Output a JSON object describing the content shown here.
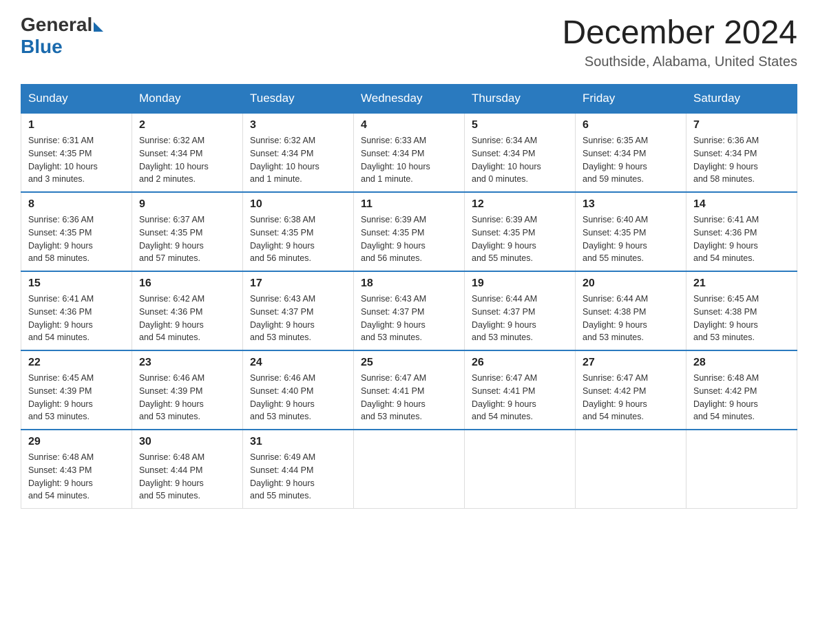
{
  "header": {
    "logo_general": "General",
    "logo_blue": "Blue",
    "title": "December 2024",
    "subtitle": "Southside, Alabama, United States"
  },
  "days_of_week": [
    "Sunday",
    "Monday",
    "Tuesday",
    "Wednesday",
    "Thursday",
    "Friday",
    "Saturday"
  ],
  "weeks": [
    [
      {
        "day": "1",
        "info": "Sunrise: 6:31 AM\nSunset: 4:35 PM\nDaylight: 10 hours\nand 3 minutes."
      },
      {
        "day": "2",
        "info": "Sunrise: 6:32 AM\nSunset: 4:34 PM\nDaylight: 10 hours\nand 2 minutes."
      },
      {
        "day": "3",
        "info": "Sunrise: 6:32 AM\nSunset: 4:34 PM\nDaylight: 10 hours\nand 1 minute."
      },
      {
        "day": "4",
        "info": "Sunrise: 6:33 AM\nSunset: 4:34 PM\nDaylight: 10 hours\nand 1 minute."
      },
      {
        "day": "5",
        "info": "Sunrise: 6:34 AM\nSunset: 4:34 PM\nDaylight: 10 hours\nand 0 minutes."
      },
      {
        "day": "6",
        "info": "Sunrise: 6:35 AM\nSunset: 4:34 PM\nDaylight: 9 hours\nand 59 minutes."
      },
      {
        "day": "7",
        "info": "Sunrise: 6:36 AM\nSunset: 4:34 PM\nDaylight: 9 hours\nand 58 minutes."
      }
    ],
    [
      {
        "day": "8",
        "info": "Sunrise: 6:36 AM\nSunset: 4:35 PM\nDaylight: 9 hours\nand 58 minutes."
      },
      {
        "day": "9",
        "info": "Sunrise: 6:37 AM\nSunset: 4:35 PM\nDaylight: 9 hours\nand 57 minutes."
      },
      {
        "day": "10",
        "info": "Sunrise: 6:38 AM\nSunset: 4:35 PM\nDaylight: 9 hours\nand 56 minutes."
      },
      {
        "day": "11",
        "info": "Sunrise: 6:39 AM\nSunset: 4:35 PM\nDaylight: 9 hours\nand 56 minutes."
      },
      {
        "day": "12",
        "info": "Sunrise: 6:39 AM\nSunset: 4:35 PM\nDaylight: 9 hours\nand 55 minutes."
      },
      {
        "day": "13",
        "info": "Sunrise: 6:40 AM\nSunset: 4:35 PM\nDaylight: 9 hours\nand 55 minutes."
      },
      {
        "day": "14",
        "info": "Sunrise: 6:41 AM\nSunset: 4:36 PM\nDaylight: 9 hours\nand 54 minutes."
      }
    ],
    [
      {
        "day": "15",
        "info": "Sunrise: 6:41 AM\nSunset: 4:36 PM\nDaylight: 9 hours\nand 54 minutes."
      },
      {
        "day": "16",
        "info": "Sunrise: 6:42 AM\nSunset: 4:36 PM\nDaylight: 9 hours\nand 54 minutes."
      },
      {
        "day": "17",
        "info": "Sunrise: 6:43 AM\nSunset: 4:37 PM\nDaylight: 9 hours\nand 53 minutes."
      },
      {
        "day": "18",
        "info": "Sunrise: 6:43 AM\nSunset: 4:37 PM\nDaylight: 9 hours\nand 53 minutes."
      },
      {
        "day": "19",
        "info": "Sunrise: 6:44 AM\nSunset: 4:37 PM\nDaylight: 9 hours\nand 53 minutes."
      },
      {
        "day": "20",
        "info": "Sunrise: 6:44 AM\nSunset: 4:38 PM\nDaylight: 9 hours\nand 53 minutes."
      },
      {
        "day": "21",
        "info": "Sunrise: 6:45 AM\nSunset: 4:38 PM\nDaylight: 9 hours\nand 53 minutes."
      }
    ],
    [
      {
        "day": "22",
        "info": "Sunrise: 6:45 AM\nSunset: 4:39 PM\nDaylight: 9 hours\nand 53 minutes."
      },
      {
        "day": "23",
        "info": "Sunrise: 6:46 AM\nSunset: 4:39 PM\nDaylight: 9 hours\nand 53 minutes."
      },
      {
        "day": "24",
        "info": "Sunrise: 6:46 AM\nSunset: 4:40 PM\nDaylight: 9 hours\nand 53 minutes."
      },
      {
        "day": "25",
        "info": "Sunrise: 6:47 AM\nSunset: 4:41 PM\nDaylight: 9 hours\nand 53 minutes."
      },
      {
        "day": "26",
        "info": "Sunrise: 6:47 AM\nSunset: 4:41 PM\nDaylight: 9 hours\nand 54 minutes."
      },
      {
        "day": "27",
        "info": "Sunrise: 6:47 AM\nSunset: 4:42 PM\nDaylight: 9 hours\nand 54 minutes."
      },
      {
        "day": "28",
        "info": "Sunrise: 6:48 AM\nSunset: 4:42 PM\nDaylight: 9 hours\nand 54 minutes."
      }
    ],
    [
      {
        "day": "29",
        "info": "Sunrise: 6:48 AM\nSunset: 4:43 PM\nDaylight: 9 hours\nand 54 minutes."
      },
      {
        "day": "30",
        "info": "Sunrise: 6:48 AM\nSunset: 4:44 PM\nDaylight: 9 hours\nand 55 minutes."
      },
      {
        "day": "31",
        "info": "Sunrise: 6:49 AM\nSunset: 4:44 PM\nDaylight: 9 hours\nand 55 minutes."
      },
      {
        "day": "",
        "info": ""
      },
      {
        "day": "",
        "info": ""
      },
      {
        "day": "",
        "info": ""
      },
      {
        "day": "",
        "info": ""
      }
    ]
  ]
}
